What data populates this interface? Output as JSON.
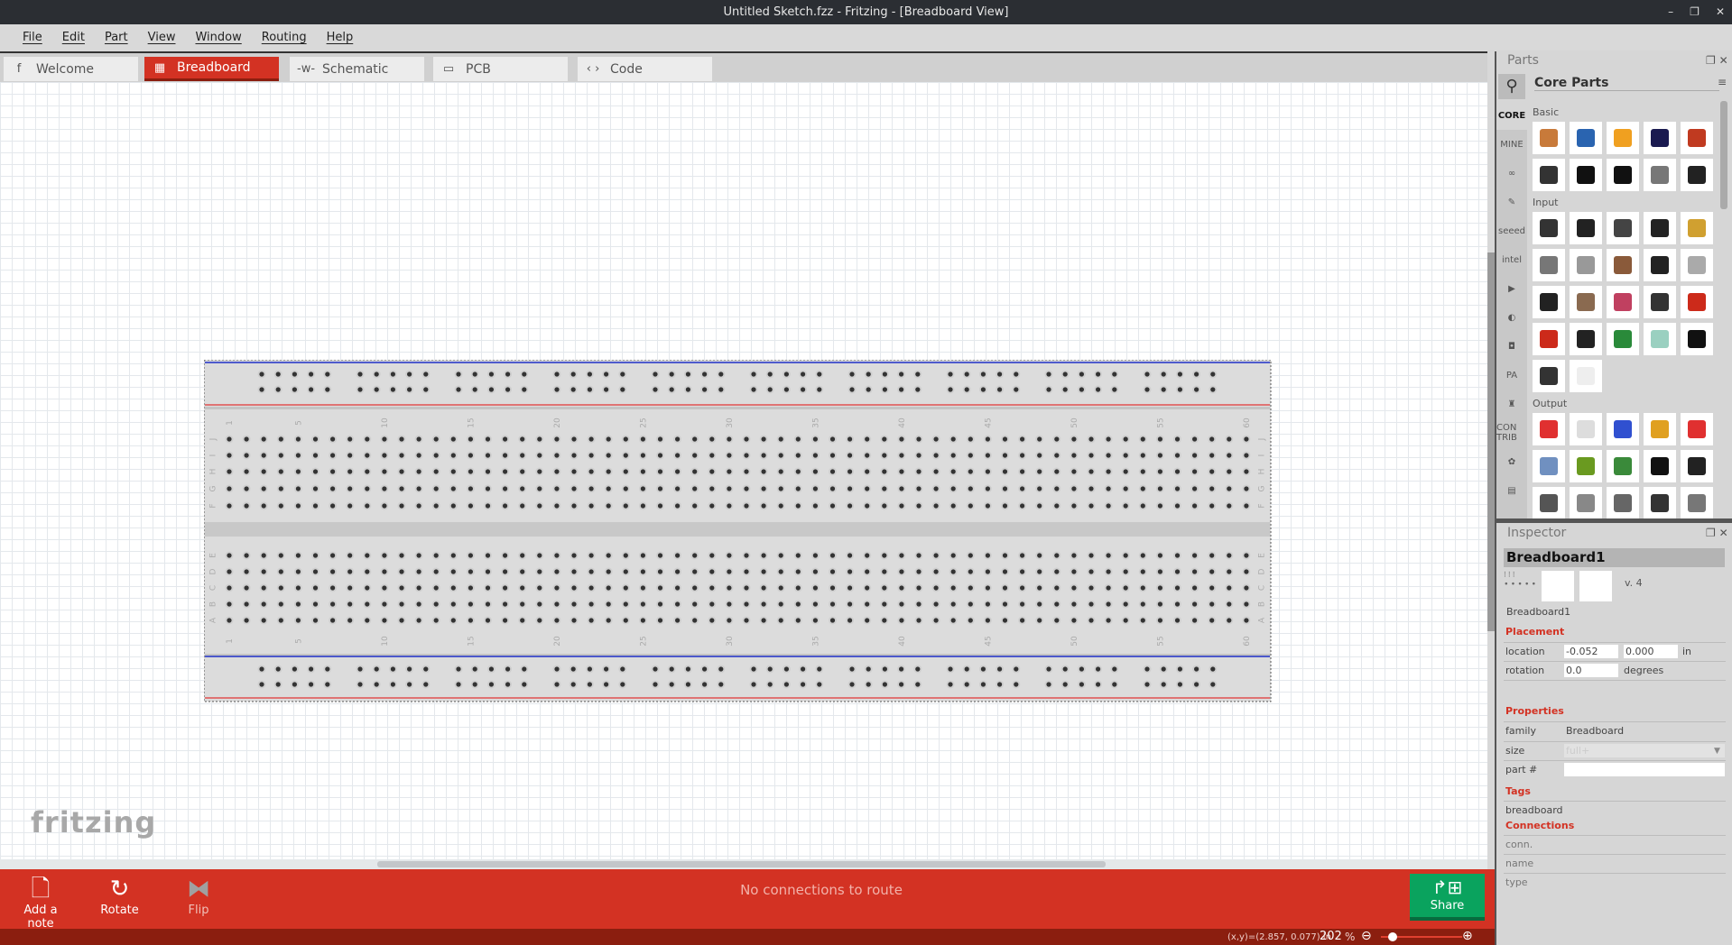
{
  "window": {
    "title": "Untitled Sketch.fzz - Fritzing - [Breadboard View]",
    "controls": [
      "–",
      "❐",
      "✕"
    ]
  },
  "menu": [
    "File",
    "Edit",
    "Part",
    "View",
    "Window",
    "Routing",
    "Help"
  ],
  "tabs": [
    {
      "label": "Welcome",
      "icon": "f"
    },
    {
      "label": "Breadboard",
      "icon": "▦",
      "active": true
    },
    {
      "label": "Schematic",
      "icon": "-ᴡ-"
    },
    {
      "label": "PCB",
      "icon": "▭"
    },
    {
      "label": "Code",
      "icon": "‹ ›"
    }
  ],
  "canvas": {
    "logo": "fritzing"
  },
  "breadboard": {
    "columns": 60,
    "column_labels": [
      "1",
      "5",
      "10",
      "15",
      "20",
      "25",
      "30",
      "35",
      "40",
      "45",
      "50",
      "55",
      "60"
    ],
    "top_rows": [
      "J",
      "I",
      "H",
      "G",
      "F"
    ],
    "bottom_rows": [
      "E",
      "D",
      "C",
      "B",
      "A"
    ],
    "rail_groups": 10,
    "colors": {
      "rail_blue": "#2030c8",
      "rail_red": "#e05050",
      "body": "#dcdcdc"
    }
  },
  "toolbar": {
    "add_note": "Add a note",
    "rotate": "Rotate",
    "flip": "Flip",
    "routing_status": "No connections to route",
    "share": "Share"
  },
  "status": {
    "coords": "(x,y)=(2.857, 0.077) in",
    "zoom": "202",
    "zoom_unit": "%",
    "zoom_level": 0.1
  },
  "parts": {
    "title": "Parts",
    "bin_title": "Core Parts",
    "bins": [
      "CORE",
      "MINE",
      "∞",
      "✎",
      "seeed",
      "intel",
      "▶",
      "◐",
      "◘",
      "PA",
      "♜",
      "CON TRIB",
      "✿",
      "▤"
    ],
    "categories": [
      {
        "name": "Basic",
        "items": [
          "#c87a3a",
          "#2a64b0",
          "#f0a020",
          "#1a1a50",
          "#c03a20",
          "#333333",
          "#111111",
          "#111111",
          "#777777",
          "#222222"
        ]
      },
      {
        "name": "Input",
        "items": [
          "#333333",
          "#222222",
          "#444444",
          "#222222",
          "#d0a030",
          "#777777",
          "#999999",
          "#8a5a3a",
          "#222222",
          "#aaaaaa",
          "#222222",
          "#8a6a50",
          "#c04060",
          "#333333",
          "#cc2a1a",
          "#cc2a1a",
          "#222222",
          "#2a8a3a",
          "#9ad0c0",
          "#111111",
          "#333333",
          "#eeeeee"
        ]
      },
      {
        "name": "Output",
        "items": [
          "#e03030",
          "#dddddd",
          "#3050d0",
          "#e0a020",
          "#e03030",
          "#7090c0",
          "#6a9a20",
          "#3a8a3a",
          "#111111",
          "#222222",
          "#555555",
          "#888888",
          "#666666",
          "#333333",
          "#777777"
        ]
      }
    ]
  },
  "inspector": {
    "title": "Inspector",
    "part_title": "Breadboard1",
    "version": "v. 4",
    "part_label": "Breadboard1",
    "placement": "Placement",
    "location_label": "location",
    "loc_x": "-0.052",
    "loc_y": "0.000",
    "loc_unit": "in",
    "rotation_label": "rotation",
    "rotation": "0.0",
    "rotation_unit": "degrees",
    "properties": "Properties",
    "family_label": "family",
    "family": "Breadboard",
    "size_label": "size",
    "size": "full+",
    "partno_label": "part #",
    "partno": "",
    "tags": "Tags",
    "tag_value": "breadboard",
    "connections": "Connections",
    "conn_label": "conn.",
    "name_label": "name",
    "type_label": "type"
  }
}
